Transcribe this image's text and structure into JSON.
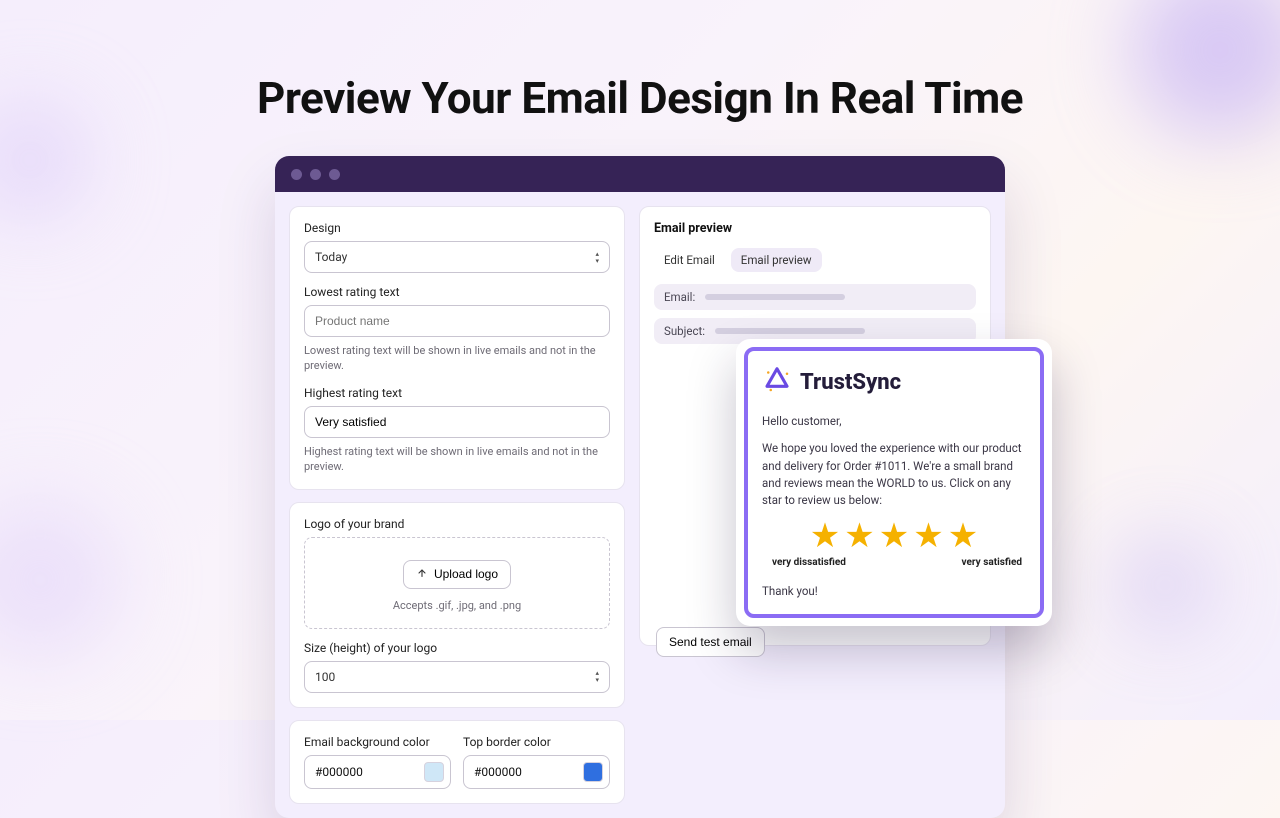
{
  "page": {
    "title": "Preview Your Email Design In Real Time"
  },
  "form": {
    "design": {
      "label": "Design",
      "value": "Today"
    },
    "lowest": {
      "label": "Lowest rating text",
      "placeholder": "Product name",
      "helper": "Lowest rating text will be shown in live emails and not in the preview."
    },
    "highest": {
      "label": "Highest rating text",
      "value": "Very satisfied",
      "helper": "Highest rating text will be shown in live emails and not in the preview."
    },
    "logo": {
      "label": "Logo of your brand",
      "upload_label": "Upload logo",
      "accepts": "Accepts .gif, .jpg, and .png"
    },
    "logo_size": {
      "label": "Size (height) of your logo",
      "value": "100"
    },
    "bg_color": {
      "label": "Email background color",
      "value": "#000000",
      "swatch": "#cfe7f7"
    },
    "border_color": {
      "label": "Top border color",
      "value": "#000000",
      "swatch": "#2f6fe0"
    }
  },
  "preview": {
    "title": "Email preview",
    "tabs": {
      "edit": "Edit Email",
      "preview": "Email preview"
    },
    "email_label": "Email:",
    "subject_label": "Subject:",
    "send_label": "Send test email"
  },
  "email": {
    "brand": "TrustSync",
    "greeting": "Hello customer,",
    "body": "We hope you loved the experience with our product and delivery for Order #1011. We're a small brand and reviews mean the WORLD to us. Click on any star to review us below:",
    "low_label": "very dissatisfied",
    "high_label": "very satisfied",
    "thanks": "Thank you!"
  }
}
